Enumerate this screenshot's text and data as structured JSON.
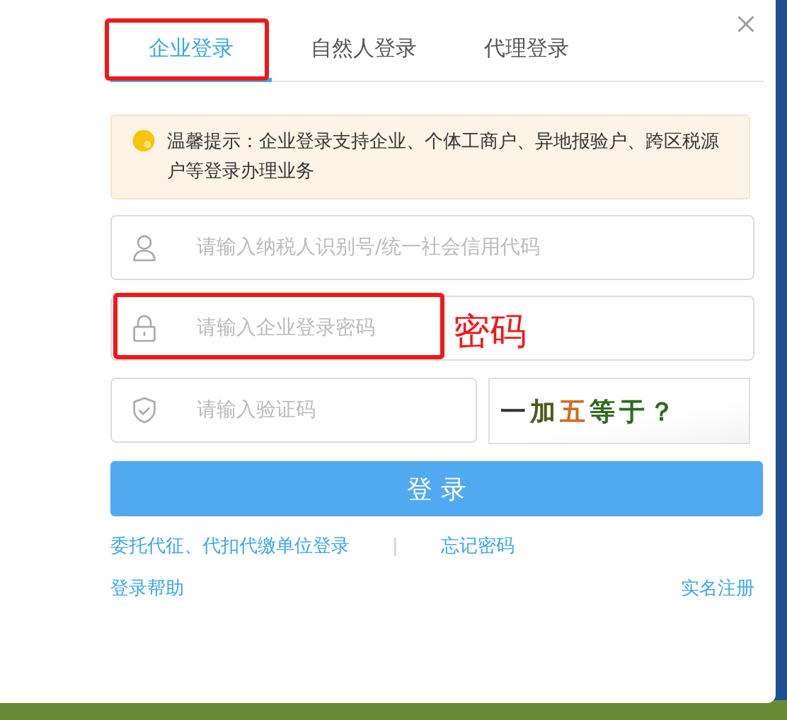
{
  "tabs": [
    {
      "label": "企业登录",
      "selected": true,
      "highlighted": true
    },
    {
      "label": "自然人登录",
      "selected": false,
      "highlighted": false
    },
    {
      "label": "代理登录",
      "selected": false,
      "highlighted": false
    }
  ],
  "notice": {
    "text": "温馨提示：企业登录支持企业、个体工商户、异地报验户、跨区税源户等登录办理业务"
  },
  "fields": [
    {
      "kind": "user",
      "placeholder": "请输入纳税人识别号/统一社会信用代码",
      "highlighted": false
    },
    {
      "kind": "lock",
      "placeholder": "请输入企业登录密码",
      "highlighted": true,
      "annotation": "密码"
    }
  ],
  "captcha": {
    "placeholder": "请输入验证码",
    "image_text": "一加五等于？"
  },
  "login_button": "登 录",
  "links": [
    {
      "label": "委托代征、代扣代缴单位登录"
    },
    {
      "label": "忘记密码"
    }
  ],
  "separator": "|",
  "footer_links": [
    {
      "label": "登录帮助"
    },
    {
      "label": "实名注册"
    }
  ]
}
